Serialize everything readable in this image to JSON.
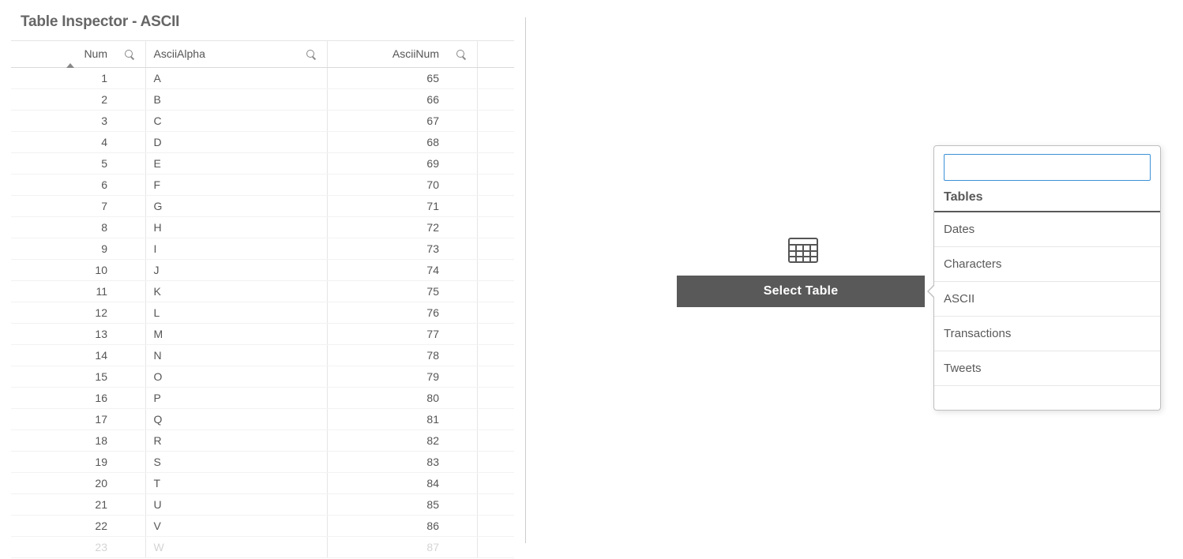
{
  "title": "Table Inspector - ASCII",
  "columns": {
    "num": "Num",
    "alpha": "AsciiAlpha",
    "ascii_num": "AsciiNum"
  },
  "rows": [
    {
      "num": "1",
      "alpha": "A",
      "ascii": "65"
    },
    {
      "num": "2",
      "alpha": "B",
      "ascii": "66"
    },
    {
      "num": "3",
      "alpha": "C",
      "ascii": "67"
    },
    {
      "num": "4",
      "alpha": "D",
      "ascii": "68"
    },
    {
      "num": "5",
      "alpha": "E",
      "ascii": "69"
    },
    {
      "num": "6",
      "alpha": "F",
      "ascii": "70"
    },
    {
      "num": "7",
      "alpha": "G",
      "ascii": "71"
    },
    {
      "num": "8",
      "alpha": "H",
      "ascii": "72"
    },
    {
      "num": "9",
      "alpha": "I",
      "ascii": "73"
    },
    {
      "num": "10",
      "alpha": "J",
      "ascii": "74"
    },
    {
      "num": "11",
      "alpha": "K",
      "ascii": "75"
    },
    {
      "num": "12",
      "alpha": "L",
      "ascii": "76"
    },
    {
      "num": "13",
      "alpha": "M",
      "ascii": "77"
    },
    {
      "num": "14",
      "alpha": "N",
      "ascii": "78"
    },
    {
      "num": "15",
      "alpha": "O",
      "ascii": "79"
    },
    {
      "num": "16",
      "alpha": "P",
      "ascii": "80"
    },
    {
      "num": "17",
      "alpha": "Q",
      "ascii": "81"
    },
    {
      "num": "18",
      "alpha": "R",
      "ascii": "82"
    },
    {
      "num": "19",
      "alpha": "S",
      "ascii": "83"
    },
    {
      "num": "20",
      "alpha": "T",
      "ascii": "84"
    },
    {
      "num": "21",
      "alpha": "U",
      "ascii": "85"
    },
    {
      "num": "22",
      "alpha": "V",
      "ascii": "86"
    },
    {
      "num": "23",
      "alpha": "W",
      "ascii": "87"
    }
  ],
  "select_button": "Select Table",
  "popover": {
    "search_value": "",
    "heading": "Tables",
    "items": [
      "Dates",
      "Characters",
      "ASCII",
      "Transactions",
      "Tweets"
    ]
  }
}
